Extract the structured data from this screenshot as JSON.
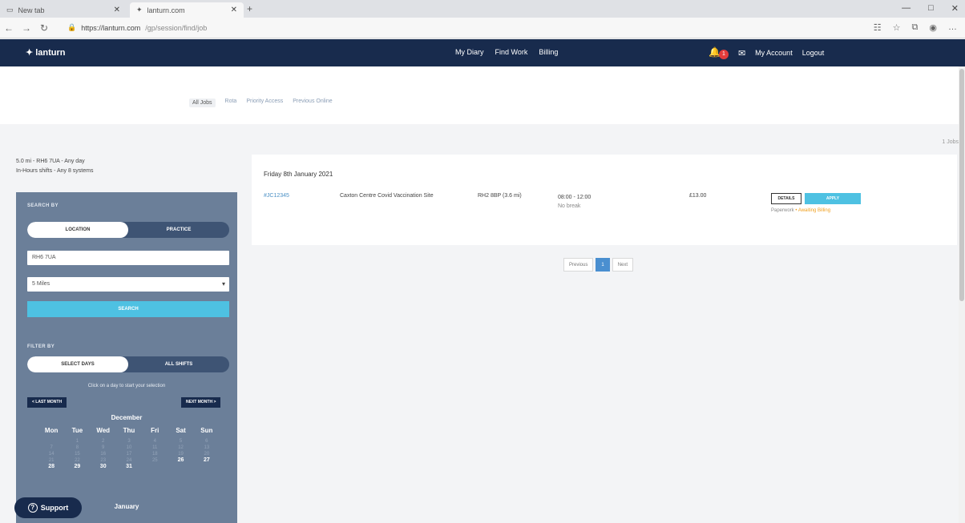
{
  "browser": {
    "tabs": [
      {
        "label": "New tab",
        "icon": "tab-page-icon"
      },
      {
        "label": "lanturn.com",
        "icon": "lanturn-logo-icon"
      }
    ],
    "url_host": "https://lanturn.com",
    "url_path": "/gp/session/find/job",
    "window_controls": [
      "—",
      "□",
      "✕"
    ]
  },
  "appnav": {
    "logo": "lanturn",
    "links": [
      "My Diary",
      "Find Work",
      "Billing"
    ],
    "notification_count": "1",
    "account": "My Account",
    "logout": "Logout"
  },
  "subtabs": [
    "All Jobs",
    "Rota",
    "Priority Access",
    "Previous Online"
  ],
  "job_count": "1 Jobs",
  "filters_summary": {
    "line1": "5.0 mi - RH6 7UA - Any day",
    "line2": "In-Hours shifts - Any 8 systems"
  },
  "sidebar": {
    "search_by_label": "SEARCH BY",
    "search_by_options": [
      "LOCATION",
      "PRACTICE"
    ],
    "postcode_value": "RH6 7UA",
    "distance_value": "5 Miles",
    "search_button": "SEARCH",
    "filter_by_label": "FILTER BY",
    "filter_by_options": [
      "SELECT DAYS",
      "ALL SHIFTS"
    ],
    "calendar_note": "Click on a day to start your selection",
    "prev_month": "< LAST MONTH",
    "next_month": "NEXT MONTH >",
    "month1": "December",
    "month2": "January",
    "weekdays": [
      "Mon",
      "Tue",
      "Wed",
      "Thu",
      "Fri",
      "Sat",
      "Sun"
    ],
    "days_inactive": [
      "",
      "1",
      "2",
      "3",
      "4",
      "5",
      "6",
      "7",
      "8",
      "9",
      "10",
      "11",
      "12",
      "13",
      "14",
      "15",
      "16",
      "17",
      "18",
      "19",
      "20",
      "21",
      "22",
      "23",
      "24",
      "25"
    ],
    "days_active": [
      "26",
      "27",
      "28",
      "29",
      "30",
      "31"
    ]
  },
  "support_label": "Support",
  "job": {
    "date_heading": "Friday 8th January 2021",
    "ref": "#JC12345",
    "site": "Caxton Centre Covid Vaccination Site",
    "postcode": "RH2 8BP (3.6 mi)",
    "time": "08:00 - 12:00",
    "time_note": "No break",
    "rate": "£13.00",
    "details_btn": "DETAILS",
    "apply_btn": "APPLY",
    "status_a": "Paperwork",
    "status_b": "Awaiting Billing"
  },
  "pager": {
    "prev": "Previous",
    "current": "1",
    "next": "Next"
  }
}
